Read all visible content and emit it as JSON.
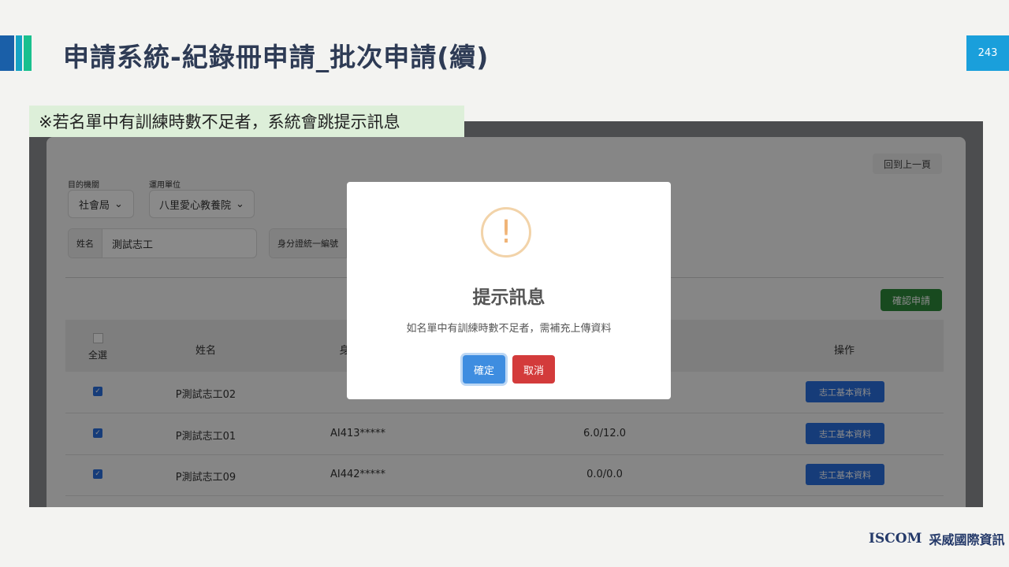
{
  "slide": {
    "title": "申請系統-紀錄冊申請_批次申請(續)",
    "page_number": "243",
    "note": "※若名單中有訓練時數不足者，系統會跳提示訊息",
    "logo_en": "ISCOM",
    "logo_zh": "采威國際資訊"
  },
  "app": {
    "back_button": "回到上一頁",
    "filters": {
      "agency_label": "目的機關",
      "agency_value": "社會局",
      "unit_label": "運用單位",
      "unit_value": "八里愛心教養院",
      "name_label": "姓名",
      "name_value": "測試志工",
      "id_label": "身分證統一編號"
    },
    "confirm_apply_button": "確認申請",
    "table": {
      "select_all_label": "全選",
      "headers": {
        "name": "姓名",
        "id": "身",
        "action": "操作"
      },
      "rows": [
        {
          "checked": true,
          "name": "P測試志工02",
          "id": "",
          "hours": "",
          "action": "志工基本資料"
        },
        {
          "checked": true,
          "name": "P測試志工01",
          "id": "AI413*****",
          "hours": "6.0/12.0",
          "action": "志工基本資料"
        },
        {
          "checked": true,
          "name": "P測試志工09",
          "id": "AI442*****",
          "hours": "0.0/0.0",
          "action": "志工基本資料"
        }
      ]
    }
  },
  "modal": {
    "icon": "exclamation-icon",
    "title": "提示訊息",
    "message": "如名單中有訓練時數不足者，需補充上傳資料",
    "ok_button": "確定",
    "cancel_button": "取消"
  },
  "colors": {
    "accent_blue": "#1a9fdb",
    "confirm_green": "#2d8a3a",
    "primary_blue": "#2a6fe0",
    "danger_red": "#d33b3b",
    "note_bg": "#ddefd9"
  }
}
